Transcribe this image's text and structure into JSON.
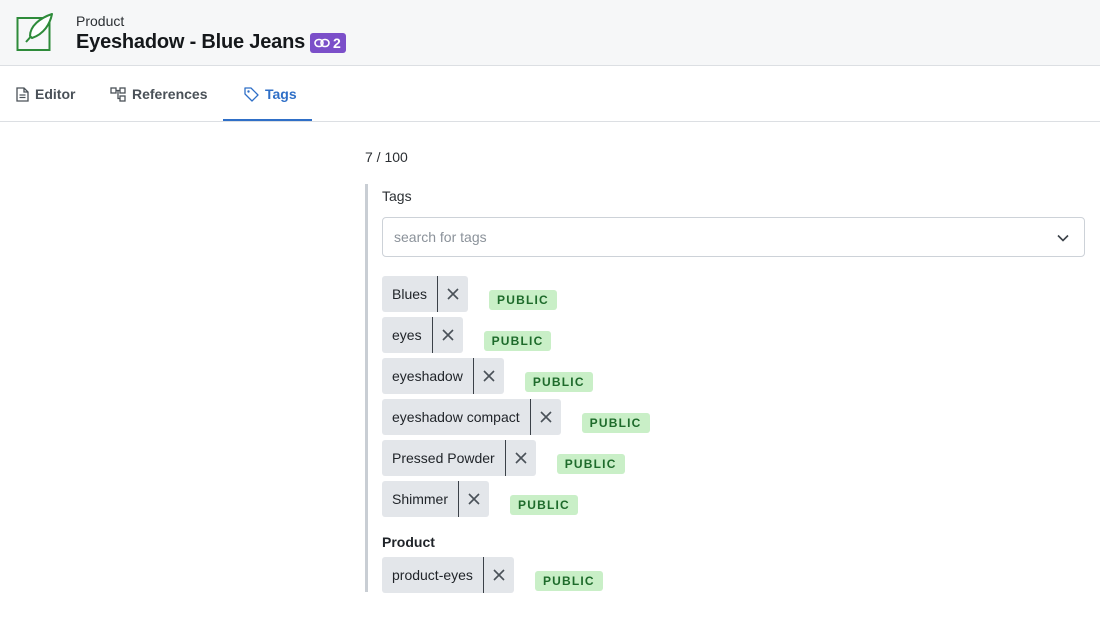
{
  "header": {
    "doc_type": "Product",
    "title": "Eyeshadow - Blue Jeans",
    "references_count": "2",
    "icon": "feather-icon",
    "accent_color": "#2e8b3a",
    "badge_color": "#7b4fc9"
  },
  "tabs": [
    {
      "label": "Editor",
      "icon": "document-icon",
      "active": false
    },
    {
      "label": "References",
      "icon": "hierarchy-icon",
      "active": false
    },
    {
      "label": "Tags",
      "icon": "tag-icon",
      "active": true
    }
  ],
  "tags_panel": {
    "counter": "7 / 100",
    "field_label": "Tags",
    "search_placeholder": "search for tags",
    "tags": [
      {
        "label": "Blues",
        "visibility": "PUBLIC"
      },
      {
        "label": "eyes",
        "visibility": "PUBLIC"
      },
      {
        "label": "eyeshadow",
        "visibility": "PUBLIC"
      },
      {
        "label": "eyeshadow compact",
        "visibility": "PUBLIC"
      },
      {
        "label": "Pressed Powder",
        "visibility": "PUBLIC"
      },
      {
        "label": "Shimmer",
        "visibility": "PUBLIC"
      }
    ],
    "product_group": {
      "label": "Product",
      "tags": [
        {
          "label": "product-eyes",
          "visibility": "PUBLIC"
        }
      ]
    }
  }
}
